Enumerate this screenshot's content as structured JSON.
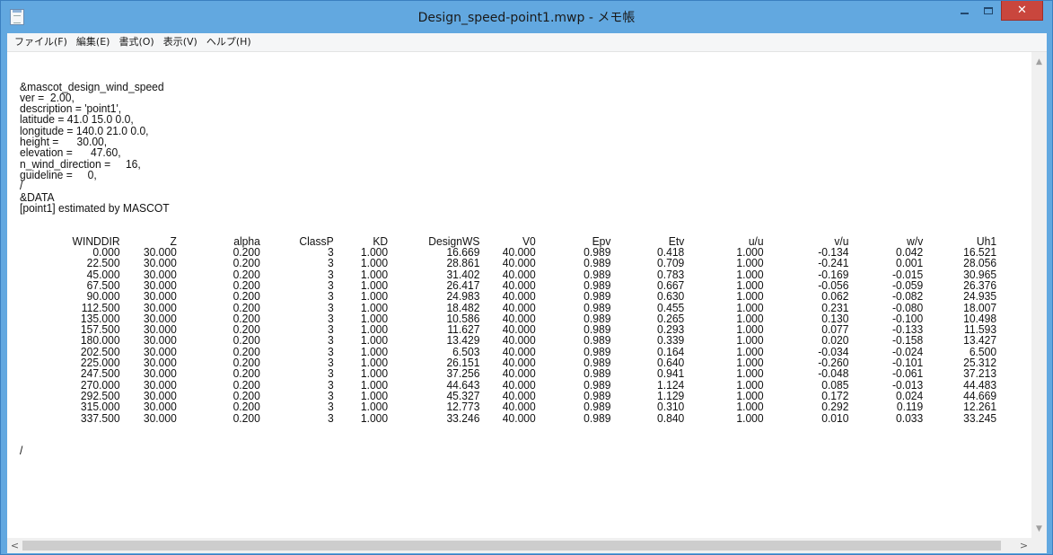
{
  "window": {
    "title": "Design_speed-point1.mwp - メモ帳",
    "icon": "notepad-icon",
    "close_glyph": "✕"
  },
  "menu": [
    "ファイル(F)",
    "編集(E)",
    "書式(O)",
    "表示(V)",
    "ヘルプ(H)"
  ],
  "document": {
    "header_lines": [
      "&mascot_design_wind_speed",
      "ver =  2.00,",
      "description = 'point1',",
      "latitude = 41.0 15.0 0.0,",
      "longitude = 140.0 21.0 0.0,",
      "height =      30.00,",
      "elevation =      47.60,",
      "n_wind_direction =     16,",
      "guideline =     0,",
      "/",
      "&DATA",
      "[point1] estimated by MASCOT"
    ],
    "columns": [
      "WINDDIR",
      "Z",
      "alpha",
      "ClassP",
      "KD",
      "DesignWS",
      "V0",
      "Epv",
      "Etv",
      "u/u",
      "v/u",
      "w/v",
      "Uh1"
    ],
    "rows": [
      [
        "0.000",
        "30.000",
        "0.200",
        "3",
        "1.000",
        "16.669",
        "40.000",
        "0.989",
        "0.418",
        "1.000",
        "-0.134",
        "0.042",
        "16.521"
      ],
      [
        "22.500",
        "30.000",
        "0.200",
        "3",
        "1.000",
        "28.861",
        "40.000",
        "0.989",
        "0.709",
        "1.000",
        "-0.241",
        "0.001",
        "28.056"
      ],
      [
        "45.000",
        "30.000",
        "0.200",
        "3",
        "1.000",
        "31.402",
        "40.000",
        "0.989",
        "0.783",
        "1.000",
        "-0.169",
        "-0.015",
        "30.965"
      ],
      [
        "67.500",
        "30.000",
        "0.200",
        "3",
        "1.000",
        "26.417",
        "40.000",
        "0.989",
        "0.667",
        "1.000",
        "-0.056",
        "-0.059",
        "26.376"
      ],
      [
        "90.000",
        "30.000",
        "0.200",
        "3",
        "1.000",
        "24.983",
        "40.000",
        "0.989",
        "0.630",
        "1.000",
        "0.062",
        "-0.082",
        "24.935"
      ],
      [
        "112.500",
        "30.000",
        "0.200",
        "3",
        "1.000",
        "18.482",
        "40.000",
        "0.989",
        "0.455",
        "1.000",
        "0.231",
        "-0.080",
        "18.007"
      ],
      [
        "135.000",
        "30.000",
        "0.200",
        "3",
        "1.000",
        "10.586",
        "40.000",
        "0.989",
        "0.265",
        "1.000",
        "0.130",
        "-0.100",
        "10.498"
      ],
      [
        "157.500",
        "30.000",
        "0.200",
        "3",
        "1.000",
        "11.627",
        "40.000",
        "0.989",
        "0.293",
        "1.000",
        "0.077",
        "-0.133",
        "11.593"
      ],
      [
        "180.000",
        "30.000",
        "0.200",
        "3",
        "1.000",
        "13.429",
        "40.000",
        "0.989",
        "0.339",
        "1.000",
        "0.020",
        "-0.158",
        "13.427"
      ],
      [
        "202.500",
        "30.000",
        "0.200",
        "3",
        "1.000",
        "6.503",
        "40.000",
        "0.989",
        "0.164",
        "1.000",
        "-0.034",
        "-0.024",
        "6.500"
      ],
      [
        "225.000",
        "30.000",
        "0.200",
        "3",
        "1.000",
        "26.151",
        "40.000",
        "0.989",
        "0.640",
        "1.000",
        "-0.260",
        "-0.101",
        "25.312"
      ],
      [
        "247.500",
        "30.000",
        "0.200",
        "3",
        "1.000",
        "37.256",
        "40.000",
        "0.989",
        "0.941",
        "1.000",
        "-0.048",
        "-0.061",
        "37.213"
      ],
      [
        "270.000",
        "30.000",
        "0.200",
        "3",
        "1.000",
        "44.643",
        "40.000",
        "0.989",
        "1.124",
        "1.000",
        "0.085",
        "-0.013",
        "44.483"
      ],
      [
        "292.500",
        "30.000",
        "0.200",
        "3",
        "1.000",
        "45.327",
        "40.000",
        "0.989",
        "1.129",
        "1.000",
        "0.172",
        "0.024",
        "44.669"
      ],
      [
        "315.000",
        "30.000",
        "0.200",
        "3",
        "1.000",
        "12.773",
        "40.000",
        "0.989",
        "0.310",
        "1.000",
        "0.292",
        "0.119",
        "12.261"
      ],
      [
        "337.500",
        "30.000",
        "0.200",
        "3",
        "1.000",
        "33.246",
        "40.000",
        "0.989",
        "0.840",
        "1.000",
        "0.010",
        "0.033",
        "33.245"
      ]
    ],
    "footer_lines": [
      "/"
    ]
  },
  "scrollbars": {
    "up_icon": "chevron-up-icon",
    "down_icon": "chevron-down-icon",
    "left_glyph": "<",
    "right_glyph": ">"
  },
  "colors": {
    "titlebar": "#62a8e0",
    "close_button": "#c9463d"
  }
}
